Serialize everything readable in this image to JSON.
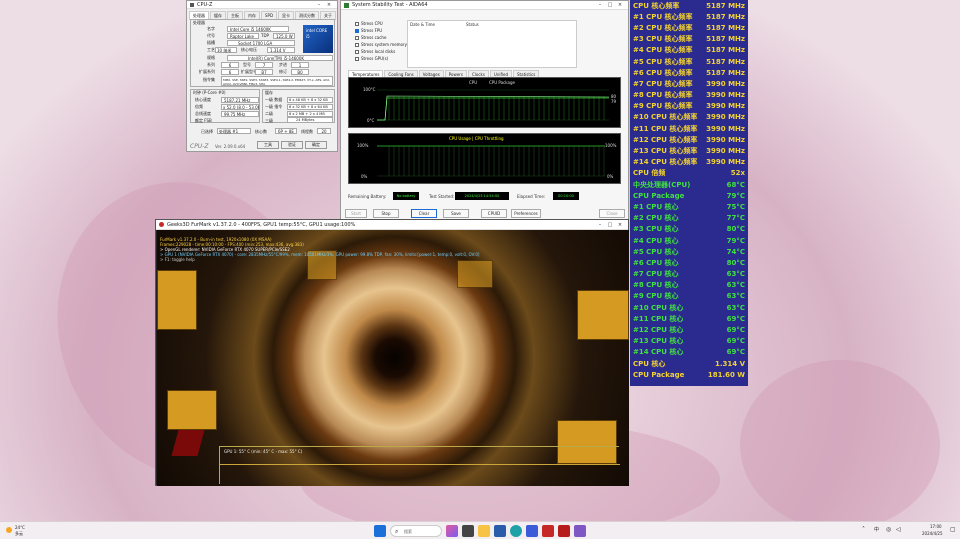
{
  "cpuz": {
    "title": "CPU-Z",
    "tabs": [
      "处理器",
      "缓存",
      "主板",
      "内存",
      "SPD",
      "显卡",
      "测试分数",
      "关于"
    ],
    "proc_group": "处理器",
    "name_label": "名字",
    "name_value": "Intel Core i5 14600K",
    "codename_label": "代号",
    "codename_value": "Raptor Lake",
    "tdp_label": "TDP",
    "tdp_value": "125.0 W",
    "package_label": "插槽",
    "package_value": "Socket 1700 LGA",
    "tech_label": "工艺",
    "tech_value": "10 纳米",
    "vcore_label": "核心电压",
    "vcore_value": "1.314 V",
    "spec_label": "规格",
    "spec_value": "Intel(R) Core(TM) i5-14600K",
    "family_label": "系列",
    "family_value": "6",
    "model_label": "型号",
    "model_value": "7",
    "stepping_label": "步进",
    "stepping_value": "1",
    "extfamily_label": "扩展系列",
    "extfamily_value": "6",
    "extmodel_label": "扩展型号",
    "extmodel_value": "B7",
    "revision_label": "修订",
    "revision_value": "B0",
    "instr_label": "指令集",
    "instr_value": "MMX, SSE, SSE2, SSE3, SSSE3, SSE4.1, SSE4.2, EM64T, VT-x, AES, AVX, AVX2, AVX-VNNI, FMA3, SHA",
    "clock_group": "时钟 (P-Core #0)",
    "cache_group": "缓存",
    "core_speed_label": "核心速度",
    "core_speed_value": "5187.21 MHz",
    "mult_label": "倍频",
    "mult_value": "x 52.0 (8.0 - 53.0)",
    "bus_label": "总线速度",
    "bus_value": "99.75 MHz",
    "fsb_label": "额定 FSB",
    "l1d_label": "一级 数据",
    "l1d_value": "6 x 48 KB + 8 x 32 KB",
    "l1i_label": "一级 指令",
    "l1i_value": "6 x 32 KB + 8 x 64 KB",
    "l2_label": "二级",
    "l2_value": "6 x 2 MB + 2 x 4 MB",
    "l3_label": "三级",
    "l3_value": "24 MBytes",
    "sel_label": "已选择",
    "sel_value": "处理器 #1",
    "cores_label": "核心数",
    "cores_value": "6P + 8E",
    "threads_label": "线程数",
    "threads_value": "20",
    "version": "Ver. 2.09.0.x64",
    "tools_label": "工具",
    "validate_label": "验证",
    "ok_label": "确定",
    "brand": "CPU-Z",
    "logo_text": "intel CORE i5"
  },
  "aida": {
    "title": "System Stability Test - AIDA64",
    "stress": [
      {
        "label": "Stress CPU",
        "checked": false
      },
      {
        "label": "Stress FPU",
        "checked": true
      },
      {
        "label": "Stress cache",
        "checked": false
      },
      {
        "label": "Stress system memory",
        "checked": false
      },
      {
        "label": "Stress local disks",
        "checked": false
      },
      {
        "label": "Stress GPU(s)",
        "checked": false
      }
    ],
    "col_date": "Date & Time",
    "col_status": "Status",
    "tabs": [
      "Temperatures",
      "Cooling Fans",
      "Voltages",
      "Powers",
      "Clocks",
      "Unified",
      "Statistics"
    ],
    "legend_cpu": "CPU",
    "legend_core": "CPU Package",
    "temp_top": "100°C",
    "temp_bottom": "0°C",
    "temp_right_a": "80",
    "temp_right_b": "79",
    "usage_title": "CPU Usage | CPU Throttling",
    "usage_top": "100%",
    "usage_bottom": "0%",
    "usage_right_top": "100%",
    "usage_right_bottom": "0%",
    "battery_label": "Remaining Battery:",
    "battery_value": "No battery",
    "started_label": "Test Started:",
    "started_value": "2024/4/25 14:54:00",
    "elapsed_label": "Elapsed Time:",
    "elapsed_value": "00:10:00",
    "buttons": [
      "Start",
      "Stop",
      "Clear",
      "Save",
      "CPUID",
      "Preferences",
      "Close"
    ]
  },
  "furmark": {
    "title": "Geeks3D FurMark v1.37.2.0 - 400FPS, GPU1 temp:55°C, GPU1 usage:100%",
    "osd_lines": [
      "FurMark v1.37.2.0 - Burn-in test, 1920x1080 (0X MSAA)",
      "Frames:229028 - time:00:10:00 - FPS:400 (min:253, max:436, avg:383)",
      "> OpenGL renderer: NVIDIA GeForce RTX 4070 SUPER/PCIe/SSE2",
      "> GPU 1 (NVIDIA GeForce RTX 4070) - core: 2835MHz/55°C/99%, mem: 10501MHz/3%, GPU power: 99.8% TDP, fan: 30%, limits:[power:1, temp:0, volt:0, OV:0]",
      "> F1: toggle help"
    ],
    "graph_label": "GPU 1: 55° C (min: 45° C - max: 55° C)"
  },
  "osd": {
    "text_color": "#f2d230",
    "temp_color": "#3fe03f",
    "rows": [
      {
        "label": "CPU 核心频率",
        "value": "5187 MHz",
        "kind": "freq"
      },
      {
        "label": "#1 CPU 核心频率",
        "value": "5187 MHz",
        "kind": "freq"
      },
      {
        "label": "#2 CPU 核心频率",
        "value": "5187 MHz",
        "kind": "freq"
      },
      {
        "label": "#3 CPU 核心频率",
        "value": "5187 MHz",
        "kind": "freq"
      },
      {
        "label": "#4 CPU 核心频率",
        "value": "5187 MHz",
        "kind": "freq"
      },
      {
        "label": "#5 CPU 核心频率",
        "value": "5187 MHz",
        "kind": "freq"
      },
      {
        "label": "#6 CPU 核心频率",
        "value": "5187 MHz",
        "kind": "freq"
      },
      {
        "label": "#7 CPU 核心频率",
        "value": "3990 MHz",
        "kind": "freq"
      },
      {
        "label": "#8 CPU 核心频率",
        "value": "3990 MHz",
        "kind": "freq"
      },
      {
        "label": "#9 CPU 核心频率",
        "value": "3990 MHz",
        "kind": "freq"
      },
      {
        "label": "#10 CPU 核心频率",
        "value": "3990 MHz",
        "kind": "freq"
      },
      {
        "label": "#11 CPU 核心频率",
        "value": "3990 MHz",
        "kind": "freq"
      },
      {
        "label": "#12 CPU 核心频率",
        "value": "3990 MHz",
        "kind": "freq"
      },
      {
        "label": "#13 CPU 核心频率",
        "value": "3990 MHz",
        "kind": "freq"
      },
      {
        "label": "#14 CPU 核心频率",
        "value": "3990 MHz",
        "kind": "freq"
      },
      {
        "label": "CPU 倍频",
        "value": "52x",
        "kind": "freq"
      },
      {
        "label": "中央处理器(CPU)",
        "value": "68°C",
        "kind": "temp"
      },
      {
        "label": "CPU Package",
        "value": "79°C",
        "kind": "temp"
      },
      {
        "label": " #1 CPU 核心",
        "value": "75°C",
        "kind": "temp"
      },
      {
        "label": " #2 CPU 核心",
        "value": "77°C",
        "kind": "temp"
      },
      {
        "label": " #3 CPU 核心",
        "value": "80°C",
        "kind": "temp"
      },
      {
        "label": " #4 CPU 核心",
        "value": "79°C",
        "kind": "temp"
      },
      {
        "label": " #5 CPU 核心",
        "value": "74°C",
        "kind": "temp"
      },
      {
        "label": " #6 CPU 核心",
        "value": "80°C",
        "kind": "temp"
      },
      {
        "label": " #7 CPU 核心",
        "value": "63°C",
        "kind": "temp"
      },
      {
        "label": " #8 CPU 核心",
        "value": "63°C",
        "kind": "temp"
      },
      {
        "label": " #9 CPU 核心",
        "value": "63°C",
        "kind": "temp"
      },
      {
        "label": " #10 CPU 核心",
        "value": "63°C",
        "kind": "temp"
      },
      {
        "label": " #11 CPU 核心",
        "value": "69°C",
        "kind": "temp"
      },
      {
        "label": " #12 CPU 核心",
        "value": "69°C",
        "kind": "temp"
      },
      {
        "label": " #13 CPU 核心",
        "value": "69°C",
        "kind": "temp"
      },
      {
        "label": " #14 CPU 核心",
        "value": "69°C",
        "kind": "temp"
      },
      {
        "label": "CPU 核心",
        "value": "1.314 V",
        "kind": "volt"
      },
      {
        "label": "CPU Package",
        "value": "181.60 W",
        "kind": "power"
      }
    ]
  },
  "taskbar": {
    "weather_temp": "24°C",
    "weather_desc": "多云",
    "search_placeholder": "搜索",
    "lang": "中",
    "time": "17:00",
    "date": "2024/4/25"
  }
}
